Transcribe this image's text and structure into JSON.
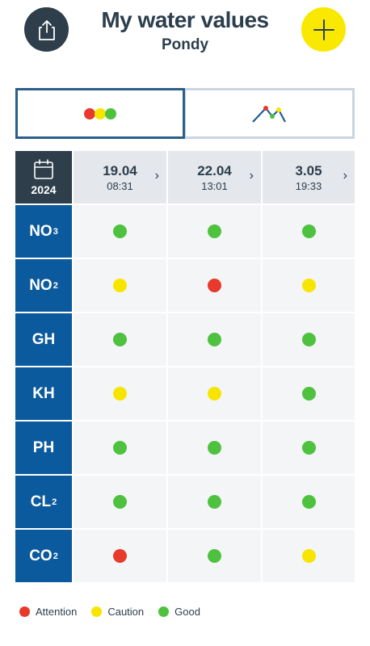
{
  "header": {
    "title": "My water values",
    "subtitle": "Pondy",
    "share_icon": "share-icon",
    "add_icon": "plus-icon"
  },
  "view_toggle": {
    "active": "traffic-light",
    "options": [
      "traffic-light-view",
      "chart-view"
    ]
  },
  "colors": {
    "red": "#e8392d",
    "yellow": "#f7e500",
    "green": "#4ec23f",
    "navy": "#0c5a9e",
    "dark": "#2e3e4a"
  },
  "table": {
    "year": "2024",
    "measurements": [
      {
        "date": "19.04",
        "time": "08:31"
      },
      {
        "date": "22.04",
        "time": "13:01"
      },
      {
        "date": "3.05",
        "time": "19:33"
      }
    ],
    "params": [
      {
        "name": "NO",
        "sub": "3",
        "values": [
          "green",
          "green",
          "green"
        ]
      },
      {
        "name": "NO",
        "sub": "2",
        "values": [
          "yellow",
          "red",
          "yellow"
        ]
      },
      {
        "name": "GH",
        "sub": "",
        "values": [
          "green",
          "green",
          "green"
        ]
      },
      {
        "name": "KH",
        "sub": "",
        "values": [
          "yellow",
          "yellow",
          "green"
        ]
      },
      {
        "name": "PH",
        "sub": "",
        "values": [
          "green",
          "green",
          "green"
        ]
      },
      {
        "name": "CL",
        "sub": "2",
        "values": [
          "green",
          "green",
          "green"
        ]
      },
      {
        "name": "CO",
        "sub": "2",
        "values": [
          "red",
          "green",
          "yellow"
        ]
      }
    ]
  },
  "legend": [
    {
      "label": "Attention",
      "color": "red"
    },
    {
      "label": "Caution",
      "color": "yellow"
    },
    {
      "label": "Good",
      "color": "green"
    }
  ]
}
